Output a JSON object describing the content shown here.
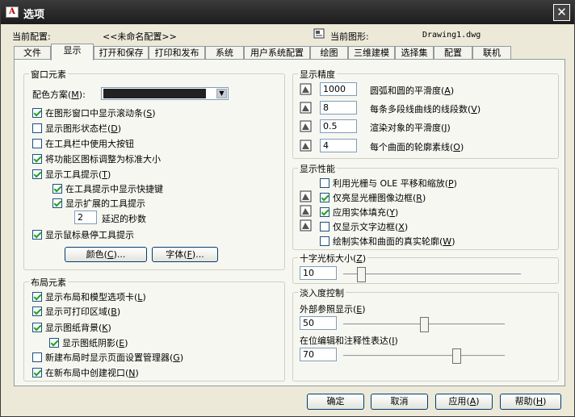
{
  "window": {
    "title": "选项",
    "app_icon_letter": "A",
    "close_glyph": "✕"
  },
  "header": {
    "profile_label": "当前配置:",
    "profile_value": "<<未命名配置>>",
    "drawing_label": "当前图形:",
    "drawing_value": "Drawing1.dwg"
  },
  "tabs": [
    "文件",
    "显示",
    "打开和保存",
    "打印和发布",
    "系统",
    "用户系统配置",
    "绘图",
    "三维建模",
    "选择集",
    "配置",
    "联机"
  ],
  "active_tab": "显示",
  "window_elements": {
    "title": "窗口元素",
    "color_scheme_label": "配色方案",
    "color_scheme_hotkey": "M",
    "color_scheme_value": "",
    "options": [
      {
        "text": "在图形窗口中显示滚动条",
        "hotkey": "S",
        "checked": true
      },
      {
        "text": "显示图形状态栏",
        "hotkey": "D",
        "checked": false
      },
      {
        "text": "在工具栏中使用大按钮",
        "hotkey": "",
        "checked": false
      },
      {
        "text": "将功能区图标调整为标准大小",
        "hotkey": "",
        "checked": true
      },
      {
        "text": "显示工具提示",
        "hotkey": "T",
        "checked": true
      },
      {
        "text": "在工具提示中显示快捷键",
        "hotkey": "",
        "checked": true
      },
      {
        "text": "显示扩展的工具提示",
        "hotkey": "",
        "checked": true
      }
    ],
    "delay_value": "2",
    "delay_label": "延迟的秒数",
    "rollover": {
      "text": "显示鼠标悬停工具提示",
      "checked": true
    },
    "colors_button": "颜色",
    "colors_hotkey": "C",
    "fonts_button": "字体",
    "fonts_hotkey": "F",
    "ellipsis": "..."
  },
  "layout_elements": {
    "title": "布局元素",
    "options": [
      {
        "text": "显示布局和模型选项卡",
        "hotkey": "L",
        "checked": true
      },
      {
        "text": "显示可打印区域",
        "hotkey": "B",
        "checked": true
      },
      {
        "text": "显示图纸背景",
        "hotkey": "K",
        "checked": true
      },
      {
        "text": "显示图纸阴影",
        "hotkey": "E",
        "checked": true
      },
      {
        "text": "新建布局时显示页面设置管理器",
        "hotkey": "G",
        "checked": false
      },
      {
        "text": "在新布局中创建视口",
        "hotkey": "N",
        "checked": true
      }
    ]
  },
  "display_resolution": {
    "title": "显示精度",
    "rows": [
      {
        "value": "1000",
        "text": "圆弧和圆的平滑度",
        "hotkey": "A"
      },
      {
        "value": "8",
        "text": "每条多段线曲线的线段数",
        "hotkey": "V"
      },
      {
        "value": "0.5",
        "text": "渲染对象的平滑度",
        "hotkey": "J"
      },
      {
        "value": "4",
        "text": "每个曲面的轮廓素线",
        "hotkey": "O"
      }
    ]
  },
  "display_performance": {
    "title": "显示性能",
    "options": [
      {
        "text": "利用光栅与 OLE 平移和缩放",
        "hotkey": "P",
        "checked": false
      },
      {
        "text": "仅亮显光栅图像边框",
        "hotkey": "R",
        "checked": true
      },
      {
        "text": "应用实体填充",
        "hotkey": "Y",
        "checked": true
      },
      {
        "text": "仅显示文字边框",
        "hotkey": "X",
        "checked": false
      },
      {
        "text": "绘制实体和曲面的真实轮廓",
        "hotkey": "W",
        "checked": false
      }
    ]
  },
  "crosshair": {
    "title": "十字光标大小",
    "hotkey": "Z",
    "value": "10",
    "level_percent": 10
  },
  "fade_control": {
    "title": "淡入度控制",
    "xref_label": "外部参照显示",
    "xref_hotkey": "E",
    "xref_value": "50",
    "xref_percent": 50,
    "inplace_label": "在位编辑和注释性表达",
    "inplace_hotkey": "I",
    "inplace_value": "70",
    "inplace_percent": 70
  },
  "footer": {
    "ok": "确定",
    "cancel": "取消",
    "apply": "应用",
    "apply_hotkey": "A",
    "help": "帮助",
    "help_hotkey": "H"
  }
}
